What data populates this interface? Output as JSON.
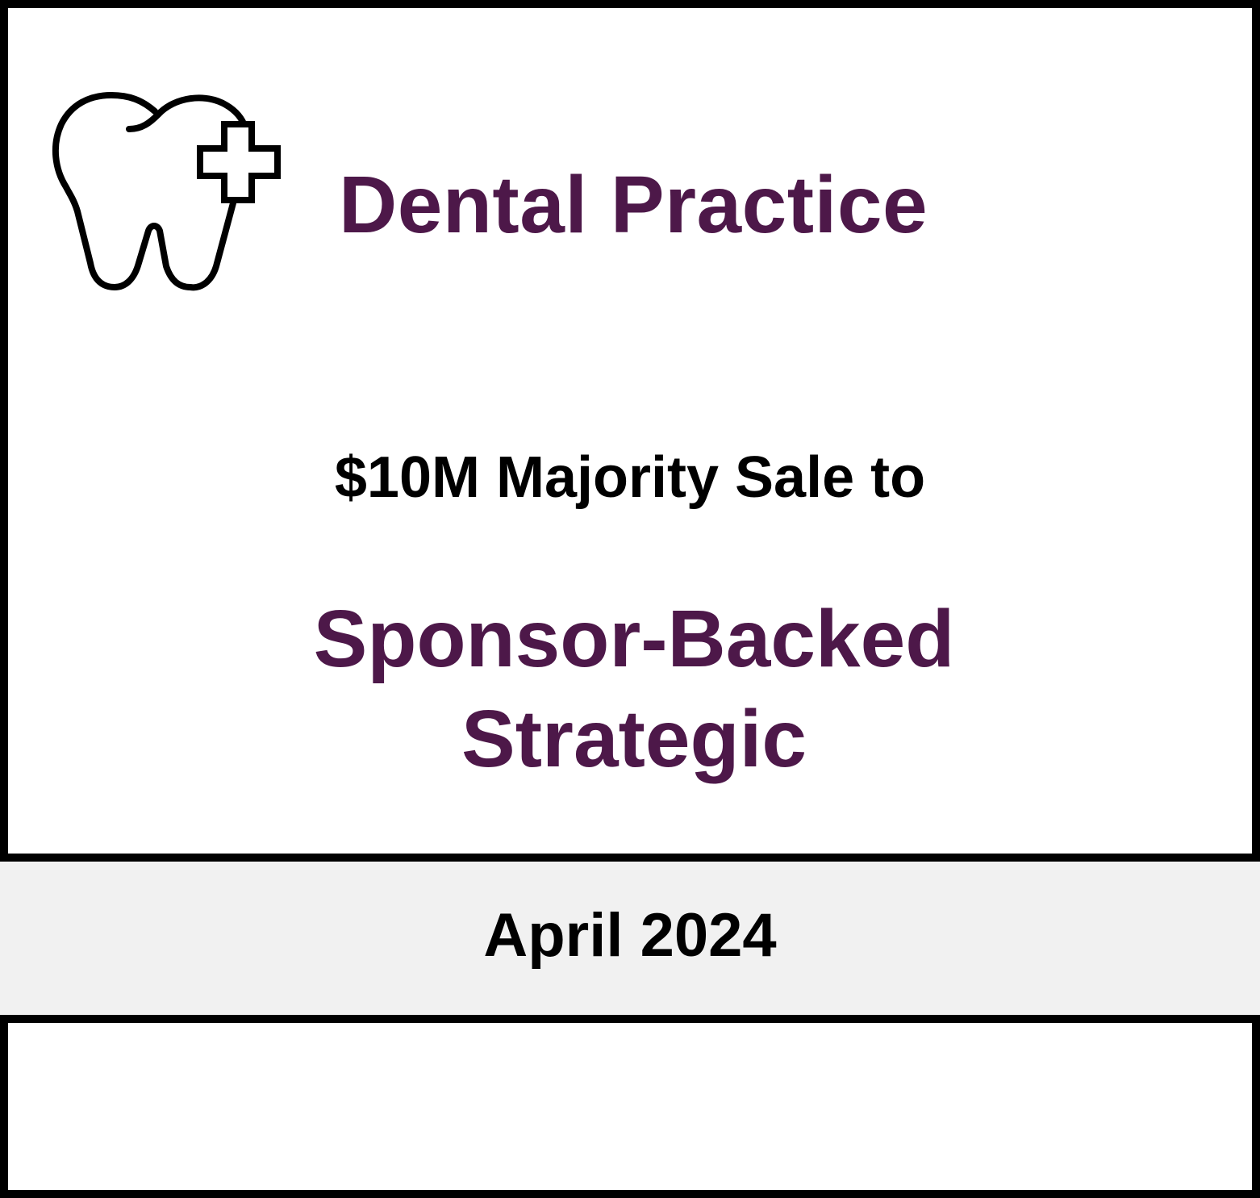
{
  "card": {
    "icon": "tooth-with-plus-icon",
    "industry": "Dental Practice",
    "deal_description": "$10M Majority Sale to",
    "buyer_type": "Sponsor-Backed Strategic",
    "date": "April 2024"
  },
  "colors": {
    "accent": "#4d1849",
    "text": "#000000",
    "band": "#f1f1f1",
    "border": "#000000",
    "background": "#ffffff"
  }
}
